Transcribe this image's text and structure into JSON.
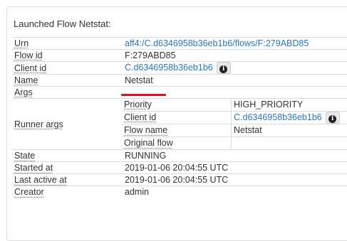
{
  "panel": {
    "title": "Launched Flow Netstat:"
  },
  "rows": {
    "urn": {
      "key": "Urn",
      "value": "aff4:/C.d6346958b36eb1b6/flows/F:279ABD85"
    },
    "flow_id": {
      "key": "Flow id",
      "value": "F:279ABD85"
    },
    "client_id": {
      "key": "Client id",
      "value": "C.d6346958b36eb1b6",
      "info_icon": "info-icon"
    },
    "name": {
      "key": "Name",
      "value": "Netstat"
    },
    "args": {
      "key": "Args",
      "value": ""
    },
    "runner_args": {
      "key": "Runner args",
      "items": [
        {
          "key": "Priority",
          "value": "HIGH_PRIORITY"
        },
        {
          "key": "Client id",
          "value": "C.d6346958b36eb1b6"
        },
        {
          "key": "Flow name",
          "value": "Netstat"
        },
        {
          "key": "Original flow",
          "value": ""
        }
      ]
    },
    "state": {
      "key": "State",
      "value": "RUNNING"
    },
    "started_at": {
      "key": "Started at",
      "value": "2019-01-06 20:04:55 UTC"
    },
    "last_active_at": {
      "key": "Last active at",
      "value": "2019-01-06 20:04:55 UTC"
    },
    "creator": {
      "key": "Creator",
      "value": "admin"
    }
  },
  "colors": {
    "link": "#2a78b9",
    "highlight": "#e0101a",
    "border": "#dddddd"
  }
}
